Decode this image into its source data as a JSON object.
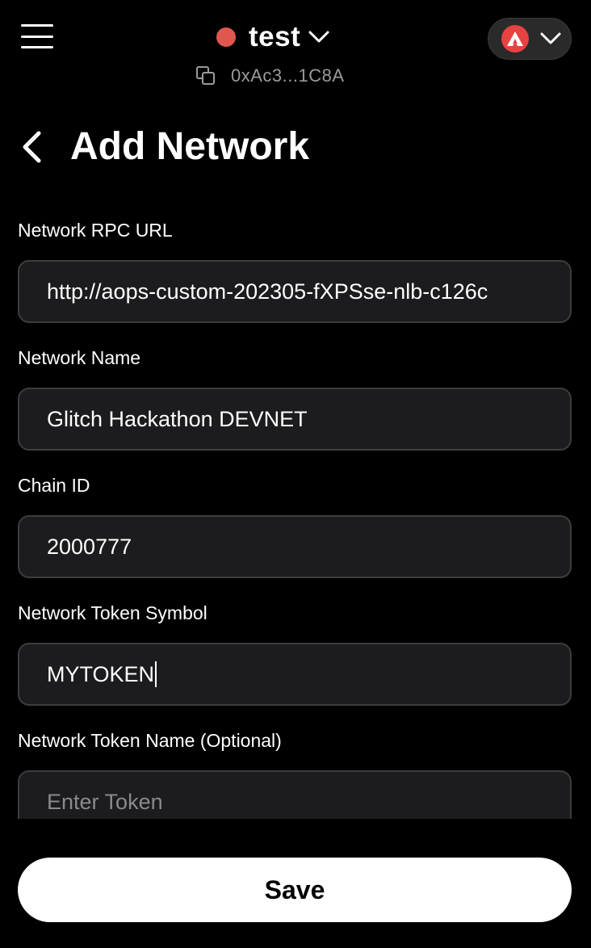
{
  "header": {
    "account_name": "test",
    "address": "0xAc3...1C8A",
    "status_color": "#e0574f",
    "network_logo_color": "#e84142",
    "icons": {
      "menu": "hamburger-icon",
      "chevron": "chevron-down-icon",
      "copy": "copy-icon",
      "network": "avalanche-logo-icon"
    }
  },
  "page": {
    "title": "Add Network",
    "back_icon": "chevron-left-icon"
  },
  "form": {
    "rpc_url": {
      "label": "Network RPC URL",
      "value": "http://aops-custom-202305-fXPSse-nlb-c126c"
    },
    "network_name": {
      "label": "Network Name",
      "value": "Glitch Hackathon DEVNET"
    },
    "chain_id": {
      "label": "Chain ID",
      "value": "2000777"
    },
    "token_symbol": {
      "label": "Network Token Symbol",
      "value": "MYTOKEN"
    },
    "token_name": {
      "label": "Network Token Name (Optional)",
      "value": "",
      "placeholder": "Enter Token"
    }
  },
  "actions": {
    "save_label": "Save"
  },
  "colors": {
    "background": "#000000",
    "input_bg": "#1c1c1e",
    "input_border": "#3d3d40",
    "button_bg": "#ffffff"
  }
}
